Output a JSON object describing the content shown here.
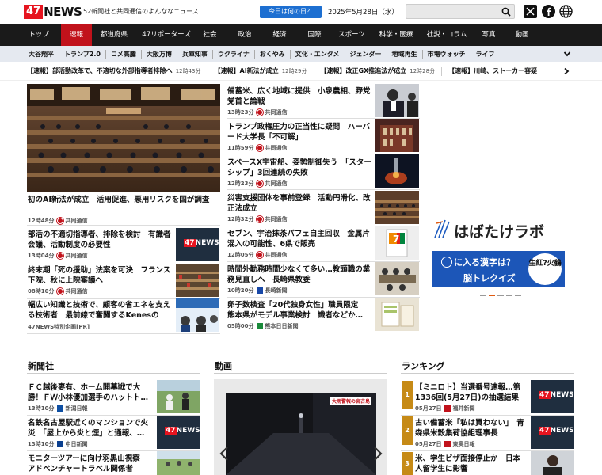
{
  "header": {
    "logo_num": "47",
    "logo_word": "NEWS",
    "tagline": "52新聞社と共同通信のよんななニュース",
    "today_btn": "今日は何の日？",
    "date": "2025年5月28日（水）"
  },
  "nav": [
    "トップ",
    "速報",
    "都道府県",
    "47リポーターズ",
    "社会",
    "政治",
    "経済",
    "国際",
    "スポーツ",
    "科学・医療",
    "社説・コラム",
    "写真",
    "動画"
  ],
  "subnav": [
    "大谷翔平",
    "トランプ2.0",
    "コメ高騰",
    "大阪万博",
    "兵庫知事",
    "ウクライナ",
    "おくやみ",
    "文化・エンタメ",
    "ジェンダー",
    "地域再生",
    "市場ウォッチ",
    "ライフ"
  ],
  "breaking": [
    {
      "text": "【速報】部活動改革で、不適切な外部指導者排除へ",
      "time": "12時43分"
    },
    {
      "text": "【速報】AI新法が成立",
      "time": "12時29分"
    },
    {
      "text": "【速報】改正GX推進法が成立",
      "time": "12時28分"
    },
    {
      "text": "【速報】川崎、ストーカー容疑",
      "time": ""
    }
  ],
  "lead": {
    "title": "初のAI新法が成立　活用促進、悪用リスクを国が調査",
    "time": "12時48分",
    "src": "共同通信"
  },
  "left_list": [
    {
      "title": "部活の不適切指導者、排除を検討　有識者会議、活動制度の必要性",
      "time": "13時04分",
      "src": "共同通信"
    },
    {
      "title": "終末期「死の援助」法案を可決　フランス下院、秋に上院審議へ",
      "time": "08時10分",
      "src": "共同通信"
    },
    {
      "title": "幅広い知識と技術で、顧客の省エネを支える技術者　最前線で奮闘するKenesの",
      "time": "47NEWS特別企画[PR]",
      "src": ""
    }
  ],
  "mid_list": [
    {
      "title": "備蓄米、広く地域に提供　小泉農相、野党党首と論戦",
      "time": "13時23分",
      "src": "共同通信"
    },
    {
      "title": "トランプ政権圧力の正当性に疑問　ハーバード大学長「不可解」",
      "time": "11時59分",
      "src": "共同通信"
    },
    {
      "title": "スペースX宇宙船、姿勢制御失う　「スターシップ」3回連続の失敗",
      "time": "12時23分",
      "src": "共同通信"
    },
    {
      "title": "災害支援団体を事前登録　活動円滑化、改正法成立",
      "time": "12時32分",
      "src": "共同通信"
    },
    {
      "title": "セブン、宇治抹茶パフェ自主回収　金属片混入の可能性、6県で販売",
      "time": "12時05分",
      "src": "共同通信"
    },
    {
      "title": "時間外勤務時間少なくて多い…教頭職の業務見直しへ　長崎県教委",
      "time": "10時20分",
      "src": "長崎新聞"
    },
    {
      "title": "卵子数検査「20代独身女性」職員限定　熊本県がモデル事業検討　識者などか…",
      "time": "05時00分",
      "src": "熊本日日新聞"
    }
  ],
  "ad": {
    "brand": "はばたけラボ",
    "quiz": "に入る漢字は？",
    "quiz2": "脳トレクイズ",
    "chars": "生紅?火鶴"
  },
  "sections": {
    "news": "新聞社",
    "video": "動画",
    "ranking": "ランキング"
  },
  "news_list": [
    {
      "title": "ＦＣ越後妻有、ホーム開幕戦で大勝！ＦＷ小林優加選手のハットト…",
      "time": "13時10分",
      "src": "新潟日報"
    },
    {
      "title": "名鉄名古屋駅近くのマンションで火災　「屋上から炎と煙」と通報、…",
      "time": "13時10分",
      "src": "中日新聞"
    },
    {
      "title": "モニターツアーに向け羽黒山視察　アドベンチャートラベル関係者",
      "time": "",
      "src": ""
    }
  ],
  "ranking_list": [
    {
      "rank": "1",
      "title": "【ミニロト】当選番号速報…第1336回(5月27日)の抽選結果",
      "time": "05月27日",
      "src": "福井新聞"
    },
    {
      "rank": "2",
      "title": "古い備蓄米「私は買わない」　青森県米穀集荷協組理事長",
      "time": "05月27日",
      "src": "東奥日報"
    },
    {
      "rank": "3",
      "title": "米、学生ビザ面接停止か　日本人留学生に影響",
      "time": "",
      "src": ""
    }
  ],
  "video": {
    "caption": "大雨警報の宮古島"
  },
  "colors": {
    "accent": "#c1121b",
    "brand_red": "#e6141f",
    "blue": "#1d6fd1"
  }
}
